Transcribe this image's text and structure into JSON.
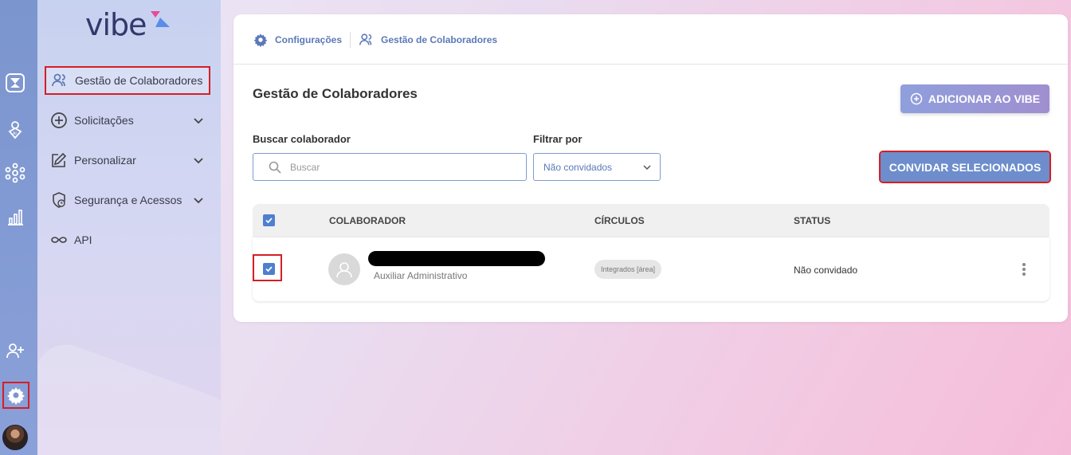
{
  "brand": {
    "logo_text": "vibe"
  },
  "colors": {
    "accent": "#6d8dcc",
    "danger_outline": "#d41f26",
    "rail": "#7b95cf"
  },
  "rail": {
    "items": [
      {
        "icon": "hourglass-app-icon"
      },
      {
        "icon": "ai-person-icon"
      },
      {
        "icon": "network-icon"
      },
      {
        "icon": "bar-chart-icon"
      },
      {
        "icon": "add-user-icon"
      },
      {
        "icon": "gear-icon"
      }
    ]
  },
  "sidebar": {
    "items": [
      {
        "label": "Gestão de Colaboradores",
        "icon": "users-icon"
      },
      {
        "label": "Solicitações",
        "icon": "plus-circle-icon"
      },
      {
        "label": "Personalizar",
        "icon": "edit-icon"
      },
      {
        "label": "Segurança e Acessos",
        "icon": "shield-clock-icon"
      },
      {
        "label": "API",
        "icon": "infinity-icon"
      }
    ]
  },
  "breadcrumb": {
    "items": [
      {
        "label": "Configurações",
        "icon": "gear-icon"
      },
      {
        "label": "Gestão de Colaboradores",
        "icon": "users-icon"
      }
    ]
  },
  "main": {
    "title": "Gestão de Colaboradores",
    "add_button": "ADICIONAR AO VIBE",
    "search_label": "Buscar colaborador",
    "search_placeholder": "Buscar",
    "filter_label": "Filtrar por",
    "filter_value": "Não convidados",
    "invite_button": "CONVIDAR SELECIONADOS"
  },
  "table": {
    "columns": [
      "COLABORADOR",
      "CÍRCULOS",
      "STATUS"
    ],
    "rows": [
      {
        "checked": true,
        "name": "",
        "role": "Auxiliar Administrativo",
        "circle": "Integrados [área]",
        "status": "Não convidado"
      }
    ]
  }
}
